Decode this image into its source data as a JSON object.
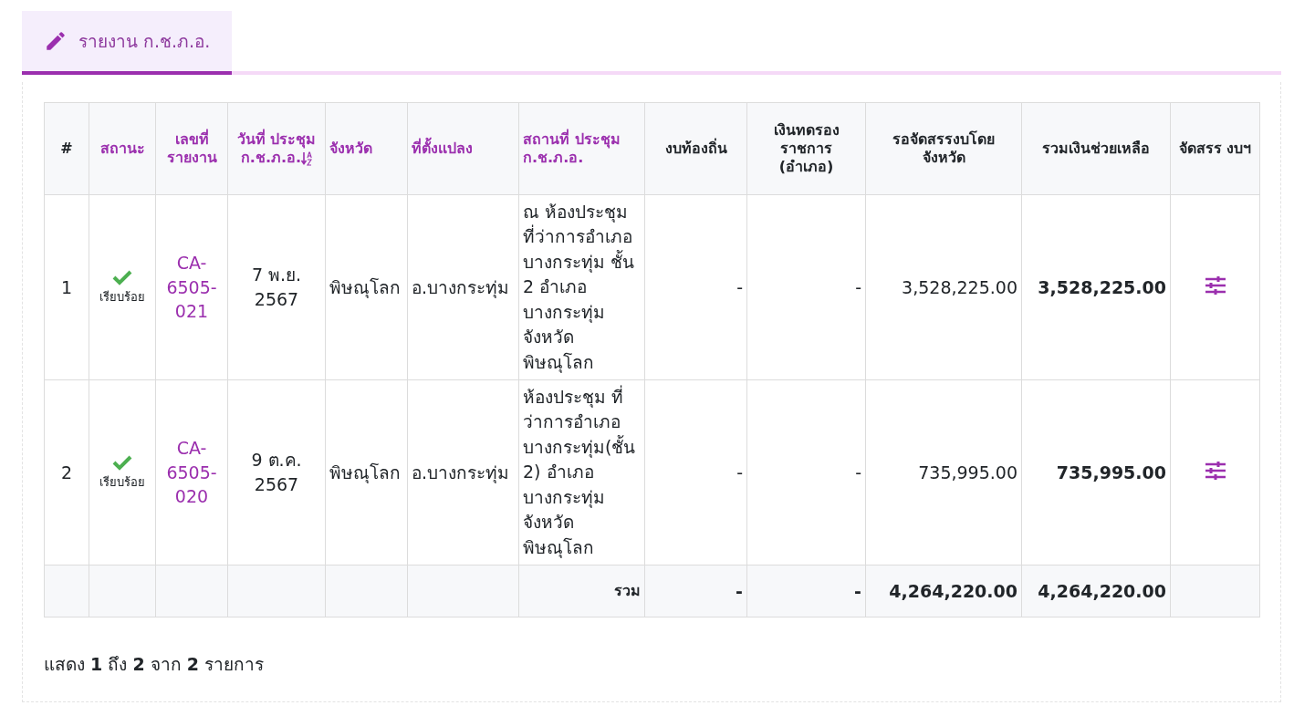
{
  "tab": {
    "label": "รายงาน ก.ช.ภ.อ.",
    "selected": true
  },
  "table": {
    "columns": [
      {
        "label": "#",
        "sortable": false,
        "sorted": false
      },
      {
        "label": "สถานะ",
        "sortable": true,
        "sorted": false
      },
      {
        "label": "เลขที่ รายงาน",
        "sortable": true,
        "sorted": false
      },
      {
        "label": "วันที่ ประชุม ก.ช.ภ.อ.",
        "sortable": true,
        "sorted": true
      },
      {
        "label": "จังหวัด",
        "sortable": true,
        "sorted": false
      },
      {
        "label": "ที่ตั้งแปลง",
        "sortable": true,
        "sorted": false
      },
      {
        "label": "สถานที่ ประชุม ก.ช.ภ.อ.",
        "sortable": true,
        "sorted": false
      },
      {
        "label": "งบท้องถิ่น",
        "sortable": false,
        "sorted": false
      },
      {
        "label": "เงินทดรอง ราชการ (อำเภอ)",
        "sortable": false,
        "sorted": false
      },
      {
        "label": "รอจัดสรรงบโดย จังหวัด",
        "sortable": false,
        "sorted": false
      },
      {
        "label": "รวมเงินช่วยเหลือ",
        "sortable": false,
        "sorted": false
      },
      {
        "label": "จัดสรร งบฯ",
        "sortable": false,
        "sorted": false
      }
    ],
    "rows": [
      {
        "index": "1",
        "status": "เรียบร้อย",
        "status_ok": true,
        "report_no": "CA-6505-021",
        "date": "7 พ.ย. 2567",
        "province": "พิษณุโลก",
        "plot": "อ.บางกระทุ่ม",
        "venue": "ณ ห้องประชุม ที่ว่าการอำเภอ บางกระทุ่ม ชั้น 2 อำเภอ บางกระทุ่ม จังหวัด พิษณุโลก",
        "local_budget": "-",
        "advance": "-",
        "pending": "3,528,225.00",
        "total": "3,528,225.00"
      },
      {
        "index": "2",
        "status": "เรียบร้อย",
        "status_ok": true,
        "report_no": "CA-6505-020",
        "date": "9 ต.ค. 2567",
        "province": "พิษณุโลก",
        "plot": "อ.บางกระทุ่ม",
        "venue": "ห้องประชุม ที่ว่าการอำเภอ บางกระทุ่ม(ชั้น 2) อำเภอ บางกระทุ่ม จังหวัด พิษณุโลก",
        "local_budget": "-",
        "advance": "-",
        "pending": "735,995.00",
        "total": "735,995.00"
      }
    ],
    "summary": {
      "label": "รวม",
      "local_budget": "-",
      "advance": "-",
      "pending": "4,264,220.00",
      "total": "4,264,220.00"
    }
  },
  "footer": "แสดง **1** ถึง **2** จาก **2** รายการ"
}
